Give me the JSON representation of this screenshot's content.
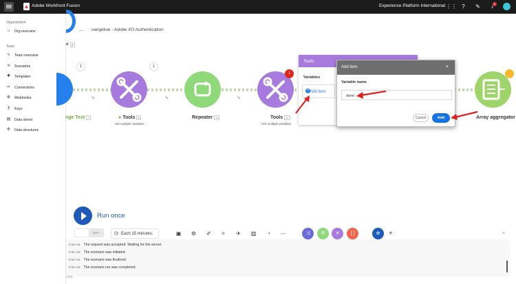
{
  "topbar": {
    "brand": "Adobe Workfront Fusion",
    "org": "Experience Platform International",
    "notification_count": "1"
  },
  "sidebar": {
    "org_section": "Organization",
    "org_items": [
      {
        "label": "Org overview",
        "icon": "home-icon"
      }
    ],
    "team_section": "Team",
    "team_items": [
      {
        "label": "Team overview",
        "icon": "chart-icon"
      },
      {
        "label": "Scenarios",
        "icon": "share-icon"
      },
      {
        "label": "Templates",
        "icon": "puzzle-icon"
      },
      {
        "label": "Connections",
        "icon": "link-icon"
      },
      {
        "label": "Webhooks",
        "icon": "globe-icon"
      },
      {
        "label": "Keys",
        "icon": "key-icon"
      },
      {
        "label": "Data stores",
        "icon": "database-icon"
      },
      {
        "label": "Data structures",
        "icon": "structure-icon"
      }
    ]
  },
  "scenario": {
    "title": "vangeluw - Adobe I/O Authentication",
    "tag_text": "d",
    "tag_count": "4"
  },
  "nodes": {
    "change_text": {
      "label": "nge Text",
      "count": "7"
    },
    "tools1": {
      "label": "Tools",
      "count": "8",
      "sub": "Set multiple variables",
      "bubble": "1"
    },
    "repeater": {
      "label": "Repeater",
      "count": "11"
    },
    "tools2": {
      "label": "Tools",
      "count": "12",
      "sub": "Get multiple variables",
      "badge": "1"
    },
    "array": {
      "label": "Array aggregator"
    },
    "first_bubble": "1"
  },
  "tools_panel": {
    "title": "Tools",
    "variables_label": "Variables",
    "add_item": "Add item"
  },
  "dialog": {
    "title": "Add item",
    "close": "×",
    "field_label": "Variable name",
    "field_value": "done",
    "cancel": "Cancel",
    "add": "Add"
  },
  "toolbar": {
    "run_once": "Run once",
    "toggle": "OFF",
    "schedule": "Each 15 minutes."
  },
  "log": {
    "rows": [
      {
        "time": "9:56 AM",
        "msg": "The request was accepted. Waiting for the server."
      },
      {
        "time": "9:56 AM",
        "msg": "The scenario was initiated."
      },
      {
        "time": "9:56 AM",
        "msg": "The scenario was finalized."
      },
      {
        "time": "9:56 AM",
        "msg": "The scenario run was completed."
      }
    ],
    "label": "LOG",
    "close": "×"
  },
  "colors": {
    "tools": "#a77bde",
    "repeater": "#8fd97a",
    "array": "#9ed46a",
    "accent": "#1473e6",
    "arrow": "#e02020"
  }
}
